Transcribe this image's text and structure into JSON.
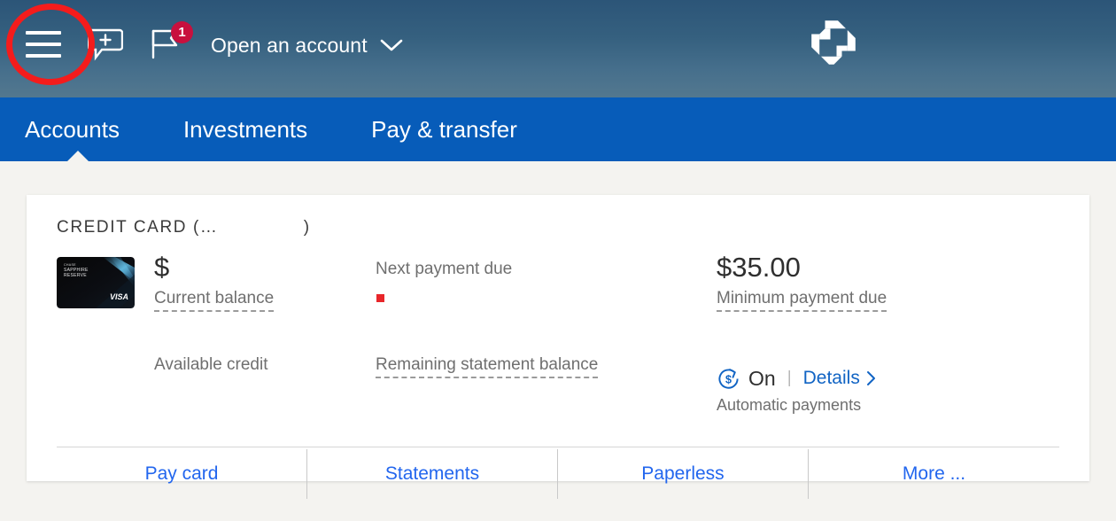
{
  "header": {
    "menu_icon": "hamburger-menu-icon",
    "chat_icon": "chat-bubble-plus-icon",
    "alerts_icon": "flag-banner-icon",
    "alerts_badge": "1",
    "open_account_label": "Open an account",
    "chevron_icon": "chevron-down-icon",
    "logo_icon": "chase-octagon-logo",
    "gradient_top": "#2c5578",
    "gradient_bottom": "#53788f",
    "annotation_color": "#f41c1c"
  },
  "nav": {
    "items": [
      {
        "label": "Accounts",
        "active": true
      },
      {
        "label": "Investments",
        "active": false
      },
      {
        "label": "Pay & transfer",
        "active": false
      }
    ],
    "background": "#075cb9"
  },
  "account_card": {
    "title": "CREDIT CARD (…              )",
    "card_art": {
      "brand_line1": "CHASE",
      "brand_line2": "SAPPHIRE",
      "brand_line3": "RESERVE",
      "network": "VISA"
    },
    "current_balance": {
      "amount": "$",
      "label": "Current balance"
    },
    "available_credit": {
      "amount": "",
      "label": "Available credit"
    },
    "next_payment_due": {
      "amount": "",
      "label": "Next payment due"
    },
    "remaining_statement_balance": {
      "amount": "",
      "label": "Remaining statement balance"
    },
    "minimum_payment_due": {
      "amount": "$35.00",
      "label": "Minimum payment due"
    },
    "automatic_payments": {
      "icon": "recurring-dollar-icon",
      "status": "On",
      "separator": "|",
      "details_label": "Details",
      "details_chevron": "chevron-right-icon",
      "label": "Automatic payments",
      "accent": "#1164c4"
    },
    "actions": [
      {
        "label": "Pay card"
      },
      {
        "label": "Statements"
      },
      {
        "label": "Paperless"
      },
      {
        "label": "More ..."
      }
    ],
    "action_link_color": "#2266ee"
  }
}
